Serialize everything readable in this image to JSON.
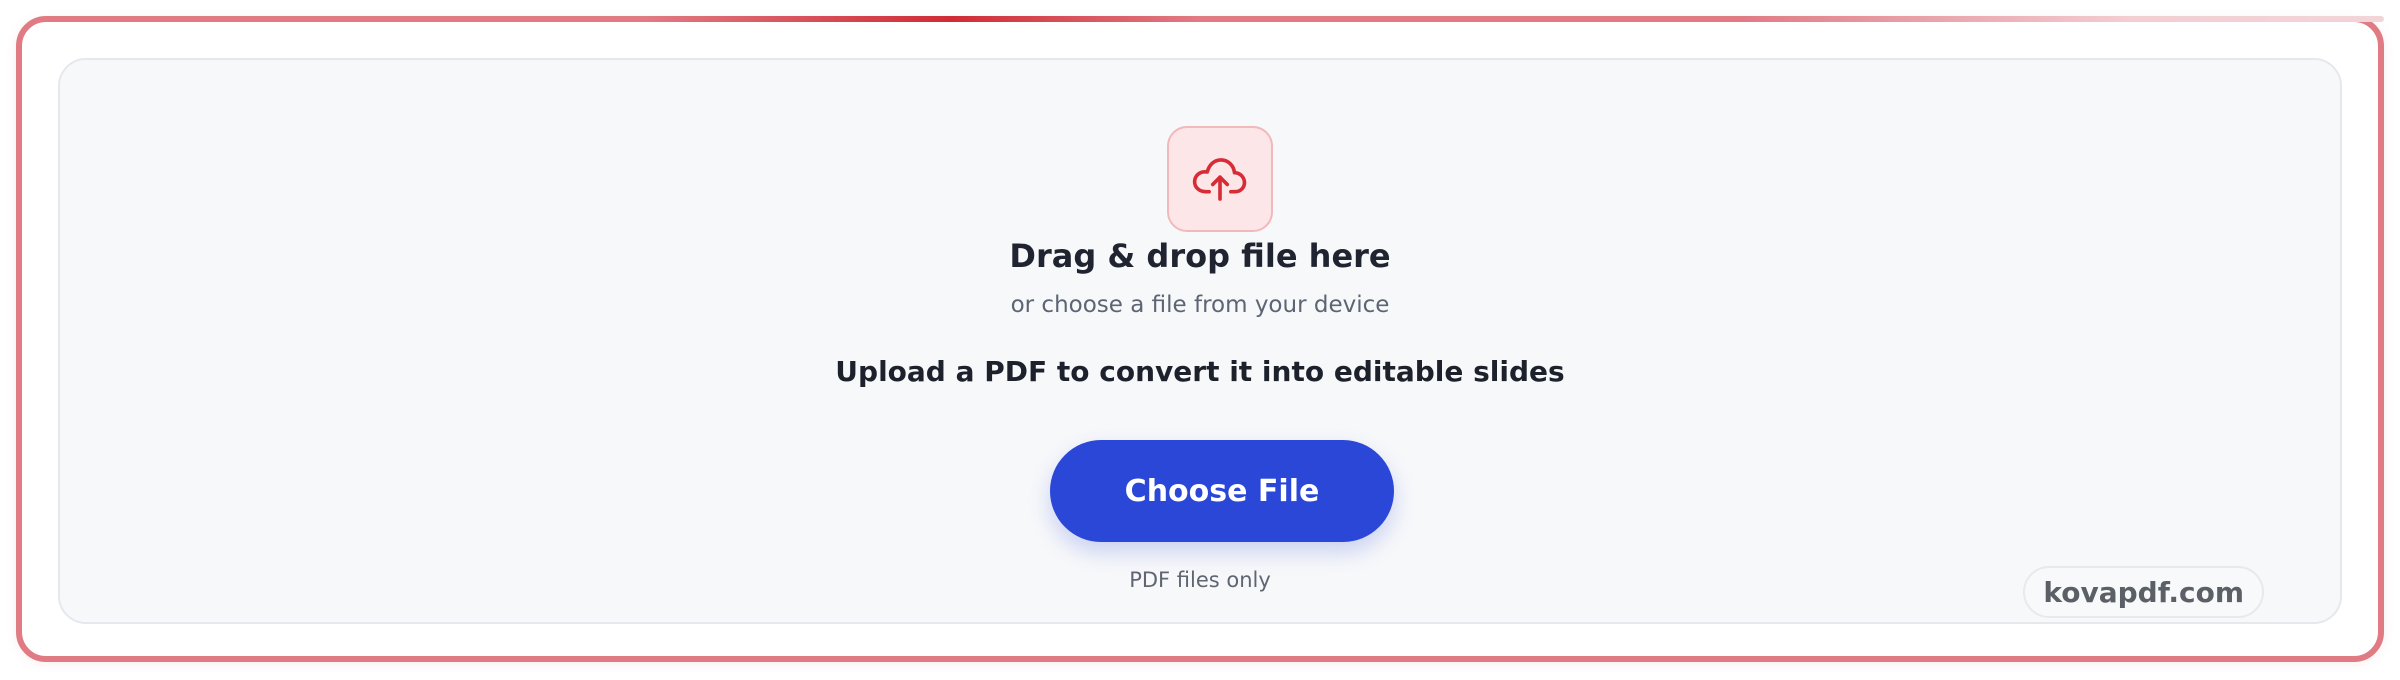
{
  "upload": {
    "title": "Drag & drop file here",
    "subtitle": "or choose a file from your device",
    "instruction": "Upload a PDF to convert it into editable slides",
    "button_label": "Choose File",
    "hint": "PDF files only",
    "icon": "cloud-upload-icon"
  },
  "brand": {
    "label": "kovapdf.com"
  },
  "colors": {
    "accent": "#2b47d8",
    "frame": "#e07b84",
    "icon_red": "#d72b36",
    "icon_tile": "#fde6e7"
  }
}
